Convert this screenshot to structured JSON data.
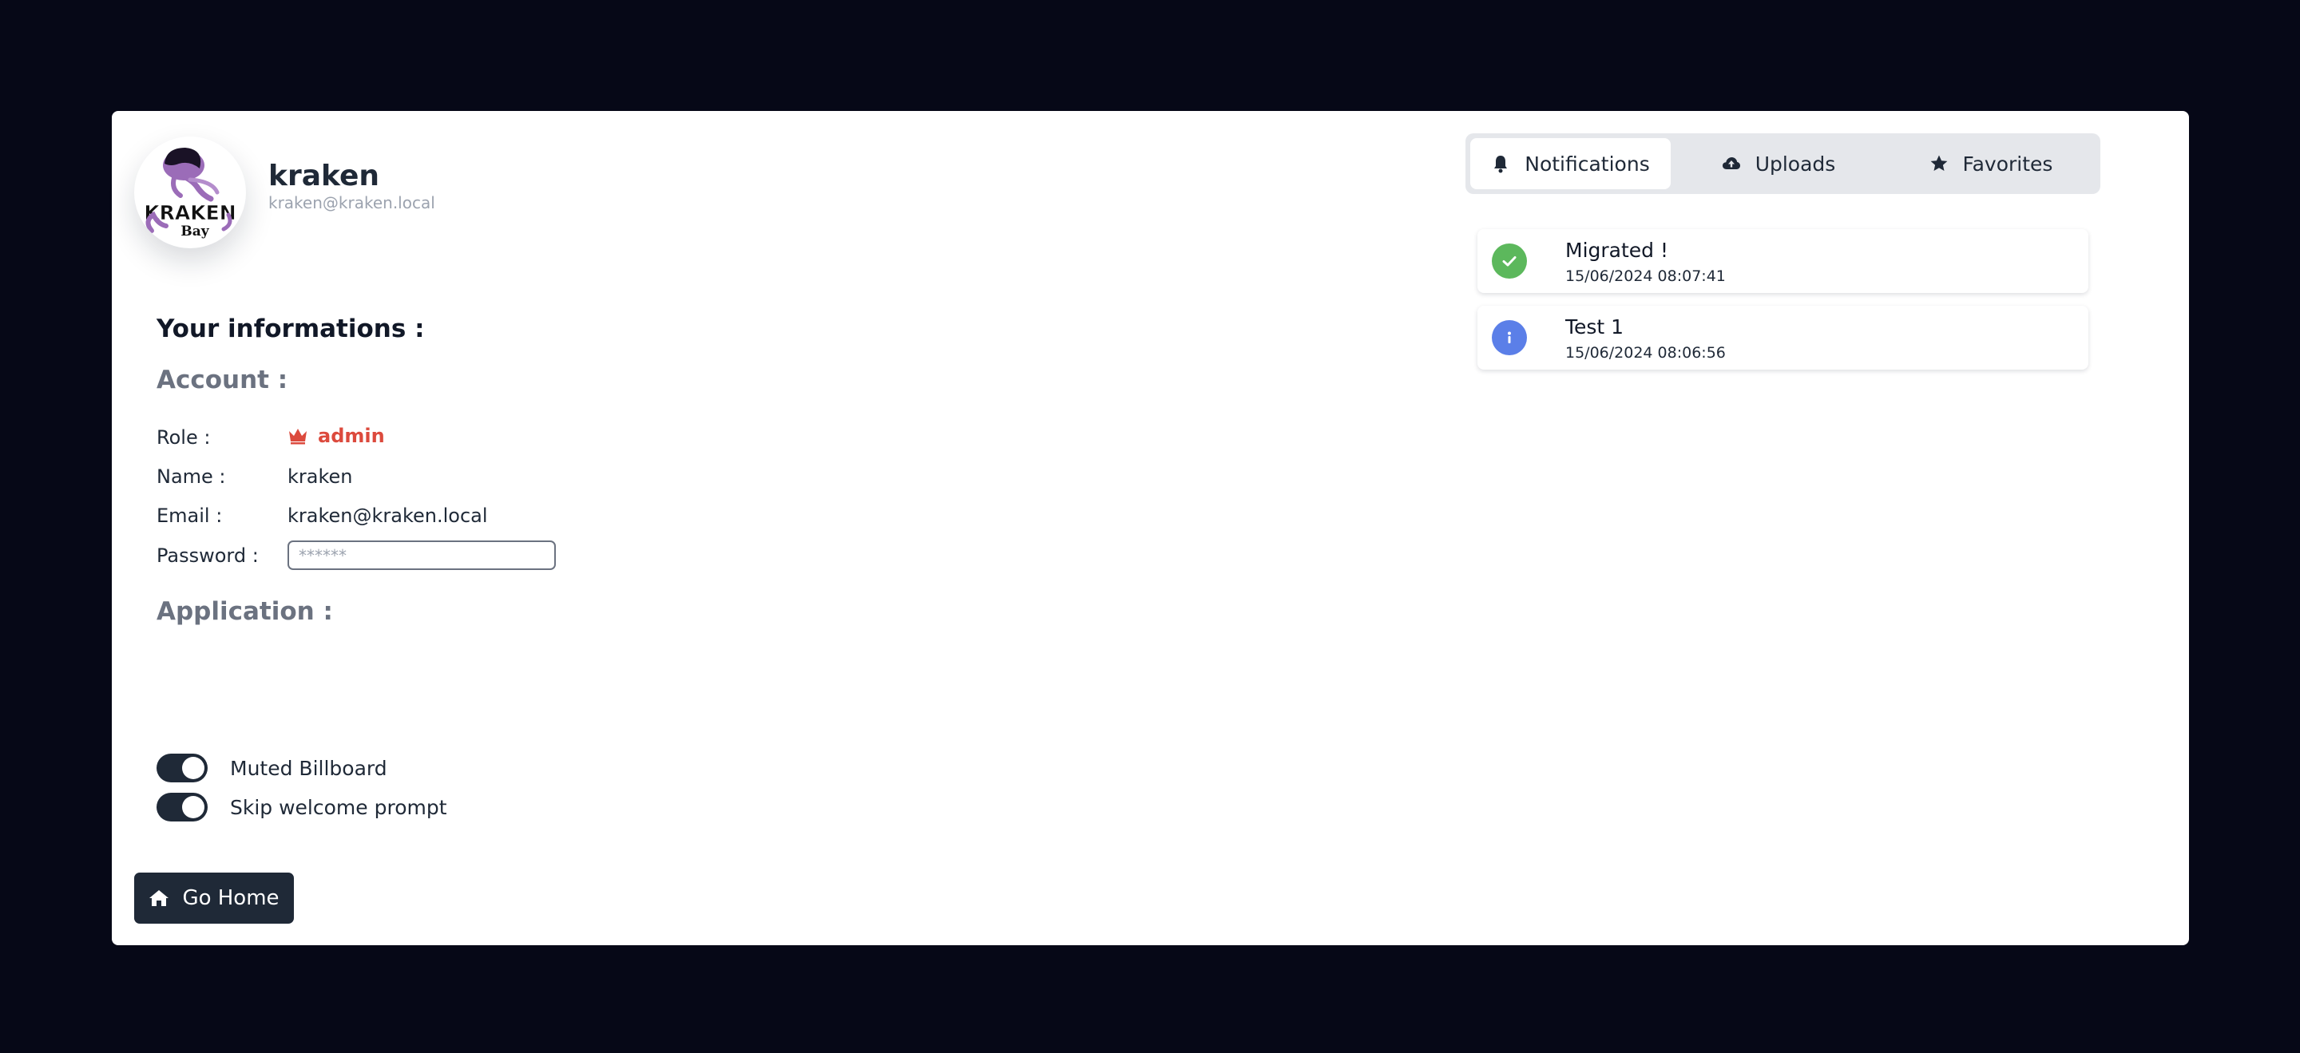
{
  "profile": {
    "username": "kraken",
    "email": "kraken@kraken.local",
    "avatar_logo_text": [
      "KRAKEN",
      "Bay"
    ]
  },
  "info": {
    "title": "Your informations :",
    "account_heading": "Account :",
    "application_heading": "Application :",
    "fields": {
      "role_label": "Role :",
      "role_value": "admin",
      "name_label": "Name :",
      "name_value": "kraken",
      "email_label": "Email :",
      "email_value": "kraken@kraken.local",
      "password_label": "Password :",
      "password_placeholder": "******"
    },
    "toggles": [
      {
        "label": "Muted Billboard",
        "enabled": true
      },
      {
        "label": "Skip welcome prompt",
        "enabled": true
      }
    ]
  },
  "home_button": {
    "label": "Go Home",
    "icon": "home-icon"
  },
  "tabs": [
    {
      "label": "Notifications",
      "icon": "bell-icon",
      "active": true
    },
    {
      "label": "Uploads",
      "icon": "cloud-upload-icon",
      "active": false
    },
    {
      "label": "Favorites",
      "icon": "star-icon",
      "active": false
    }
  ],
  "notifications": [
    {
      "title": "Migrated !",
      "time": "15/06/2024 08:07:41",
      "status": "success",
      "icon": "check-circle-icon"
    },
    {
      "title": "Test 1",
      "time": "15/06/2024 08:06:56",
      "status": "info",
      "icon": "info-circle-icon"
    }
  ],
  "colors": {
    "background": "#060817",
    "card": "#ffffff",
    "dark": "#1f2937",
    "admin_accent": "#dc4a3d",
    "success": "#5cb85c",
    "info": "#5b7fe8",
    "tab_bar": "#e5e7eb"
  }
}
